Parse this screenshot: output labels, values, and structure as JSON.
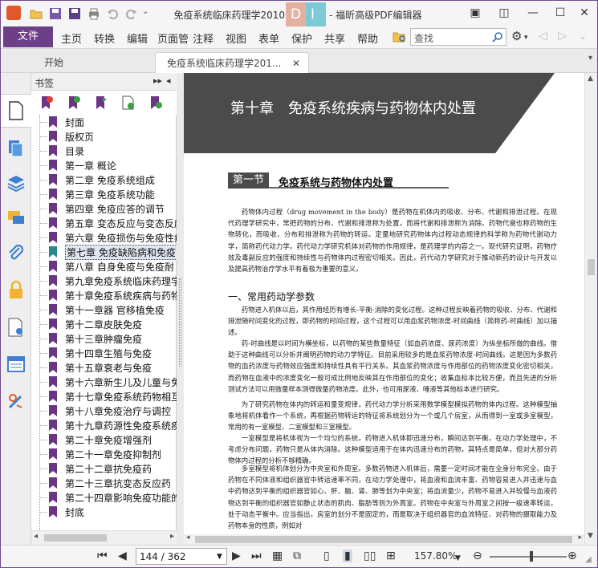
{
  "window": {
    "title": "免疫系统临床药理学2010 书签.pdf - 福昕高级PDF编辑器"
  },
  "ribbon": {
    "file_label": "文件",
    "menus": [
      "主页",
      "转换",
      "编辑",
      "页面管",
      "注释",
      "视图",
      "表单",
      "保护",
      "共享",
      "帮助"
    ],
    "search_placeholder": "查找"
  },
  "tabs": [
    {
      "label": "开始"
    },
    {
      "label": "免疫系统临床药理学201..."
    }
  ],
  "bookmarks": {
    "title": "书签",
    "items": [
      "封面",
      "版权页",
      "目录",
      "第一章 概论",
      "第二章 免疫系统组成",
      "第三章 免疫系统功能",
      "第四章 免疫应答的调节",
      "第五章 变态反应与变态反应",
      "第六章 免疫损伤与免疫性疾",
      "第七章 免疫缺陷病和免疫",
      "第八章 自身免疫与免疫耐",
      "第九章免疫系统临床药理学",
      "第十章免疫系统疾病与药物",
      "第十一章器 官移植免疫",
      "第十二章皮肤免疫",
      "第十三章肿瘤免疫",
      "第十四章生殖与免疫",
      "第十五章衰老与免疫",
      "第十六章新生儿及儿童与免",
      "第十七章免疫系统药物相互",
      "第十八章免疫治疗与调控",
      "第十九章药源性免疫系统疾",
      "第二十章免疫增强剂",
      "第二十一章免疫抑制剂",
      "第二十二章抗免疫药",
      "第二十三章抗变态反应药",
      "第二十四章影响免疫功能的",
      "封底"
    ],
    "selected_index": 9
  },
  "document": {
    "chapter_title": "第十章　免疫系统疾病与药物体内处置",
    "section_number": "第一节",
    "section_title": "免疫系统与药物体内处置",
    "para1": "药物体内过程（drug movement in the body）是药物在机体内的吸收、分布、代谢和排泄过程。在现代药理学研究中，常把药物的分布、代谢和排泄称为处置，而将代谢和排泄称为消除。药物代谢也称药物的生物转化，而吸收、分布和排泄称为药物的转运。定量地研究药物体内过程动态规律的科学称为药物代谢动力学，简称药代动力学。药代动力学研究机体对药物的作用规律，是药理学的内容之一。现代研究证明，药物疗效及毒副反应的强度和持续性与药物体内过程密切相关。因此，药代动力学研究对于推动新药的设计与开发以及提高药物治疗学水平有着极为重要的意义。",
    "heading2": "一、常用药动学参数",
    "para2": "药物进入机体以后，其作用经历有增长-平衡-消除的变化过程。这种过程反映着药物的吸收、分布、代谢和排泄随时间变化的过程，即药物的时间过程，这个过程可以用血浆药物浓度-时间曲线（简称药-时曲线）加以描述。",
    "para3": "药-时曲线是以时间为横坐标，以药物的某些数量特征（如血药浓度、尿药浓度）为纵坐标所做的曲线。借助于这种曲线可以分析并阐明药物的动力学特征。目前采用较多的是血浆药物浓度-时间曲线。这是因为多数药物的血药浓度与药物效应强度和持续性具有平行关系。其血浆药物浓度与作用部位的药物浓度变化密切相关，而药物在血液中的浓度变化一般可成比例地反映其在作用部位的变化；收集血标本比较方便，而且先进的分析测试方法可以用微量样本测得微量药物浓度。此外，也可用尿液、唾液等其他标本进行研究。",
    "para4": "为了研究药物在体内的转运和量变规律，药代动力学分析采用数学模型模拟药物的体内过程。这种模型抽象地将机体看作一个系统，再根据药物转运的特征将系统划分为一个或几个房室，从而得到一室或多室模型，常用的有一室模型、二室模型和三室模型。",
    "para5": "一室模型是将机体视为一个均匀的系统，药物进入机体即迅速分布，瞬间达到平衡。在动力学处理中，不考虑分布问题，药物只是从体内消除。这种模型适用于在体内迅速分布的药物，其特点是简单，但对大部分药物体内过程的分析不够精确。",
    "para6": "多室模型将机体划分为中央室和外周室。多数药物进入机体后，需要一定时间才能在全身分布完全。由于药物在不同体液和组织器官中转运速率不同，在动力学处理中，将血液和血流丰富、药物容易进入并迅速与血中药物达到平衡的组织器官如心、肝、脑、肾、肺等划为中央室；将血流量少，药物不易进入并较慢与血液药物达到平衡的组织器官如静止状态的肌肉、脂肪等则为外周室。药物在中央室与外周室之间按一级速率转运，处于动态平衡中。应当指出，房室的划分不是固定的，而是取决于组织器官的血流特征、对药物的摄取能力及药物本身的性质，例如对"
  },
  "status": {
    "page_text": "144 / 362",
    "zoom": "157.80%"
  }
}
